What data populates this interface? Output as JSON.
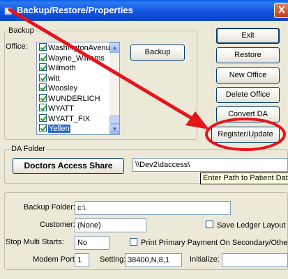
{
  "window": {
    "title": "Backup/Restore/Properties",
    "close_glyph": "X"
  },
  "backup_group": {
    "label": "Backup",
    "office_label": "Office:",
    "offices": [
      {
        "name": "WashingtonAvenu",
        "checked": true
      },
      {
        "name": "Wayne_Williams",
        "checked": true
      },
      {
        "name": "Wilmoth",
        "checked": true
      },
      {
        "name": "witt",
        "checked": true
      },
      {
        "name": "Woosley",
        "checked": true
      },
      {
        "name": "WUNDERLICH",
        "checked": true
      },
      {
        "name": "WYATT",
        "checked": true
      },
      {
        "name": "WYATT_FIX",
        "checked": true
      },
      {
        "name": "Yellen",
        "checked": true,
        "selected": true
      }
    ],
    "backup_button": "Backup"
  },
  "side_buttons": {
    "exit": "Exit",
    "restore": "Restore",
    "new_office": "New Office",
    "delete_office": "Delete Office",
    "convert_da": "Convert DA",
    "register_update": "Register/Update"
  },
  "da_folder": {
    "label": "DA Folder",
    "share_button": "Doctors Access Share",
    "path_value": "\\\\Dev2\\daccess\\",
    "tooltip": "Enter Path to Patient Data"
  },
  "settings": {
    "backup_folder_label": "Backup Folder:",
    "backup_folder_value": "c:\\",
    "customer_label": "Customer:",
    "customer_value": "(None)",
    "save_ledger_label": "Save Ledger Layout",
    "save_ledger_checked": false,
    "stop_multi_label": "Stop Multi Starts:",
    "stop_multi_value": "No",
    "print_primary_label": "Print Primary Payment On Secondary/Other",
    "print_primary_checked": false,
    "modem_port_label": "Modem Port:",
    "modem_port_value": "1",
    "setting_label": "Setting:",
    "setting_value": "38400,N,8,1",
    "initialize_label": "Initialize:",
    "initialize_value": ""
  },
  "colors": {
    "annotation_red": "#e8141b",
    "title_blue": "#0a46c8",
    "selection_blue": "#316ac5"
  },
  "icons": {
    "title": "app-icon",
    "close": "close-icon",
    "scroll_up": "scroll-up-icon",
    "scroll_down": "scroll-down-icon"
  }
}
